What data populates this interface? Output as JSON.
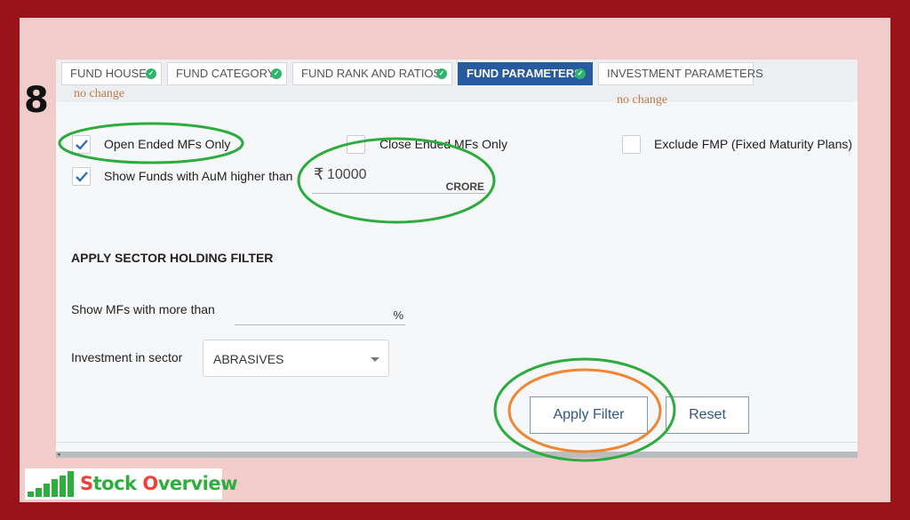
{
  "step": "8",
  "tabs": [
    {
      "label": "FUND HOUSE",
      "checked": true
    },
    {
      "label": "FUND CATEGORY",
      "checked": true
    },
    {
      "label": "FUND RANK AND RATIOS",
      "checked": true
    },
    {
      "label": "FUND PARAMETERS",
      "checked": true,
      "active": true
    },
    {
      "label": "INVESTMENT PARAMETERS",
      "checked": false
    }
  ],
  "notes": {
    "fund_house": "no change",
    "investment_parameters": "no change"
  },
  "options": {
    "open_ended": {
      "label": "Open Ended MFs Only",
      "checked": true
    },
    "close_ended": {
      "label": "Close Ended MFs Only",
      "checked": false
    },
    "exclude_fmp": {
      "label": "Exclude FMP (Fixed Maturity Plans)",
      "checked": false
    },
    "aum": {
      "label": "Show Funds with AuM higher than",
      "checked": true
    }
  },
  "aum_input": {
    "currency": "₹",
    "value": "10000",
    "unit": "CRORE"
  },
  "sector": {
    "heading": "APPLY SECTOR HOLDING FILTER",
    "more_than_label": "Show MFs with more than",
    "percent_value": "",
    "percent_sign": "%",
    "investment_label": "Investment in sector",
    "selected": "ABRASIVES"
  },
  "buttons": {
    "apply": "Apply Filter",
    "reset": "Reset"
  },
  "logo": {
    "s": "S",
    "rest1": "tock ",
    "o": "O",
    "rest2": "verview"
  },
  "colors": {
    "frame": "#98141a",
    "background": "#f2cbcb",
    "active_tab": "#275a9e",
    "check": "#2cb56b",
    "annotation_green": "#2cab3e",
    "annotation_orange": "#ee8636"
  }
}
